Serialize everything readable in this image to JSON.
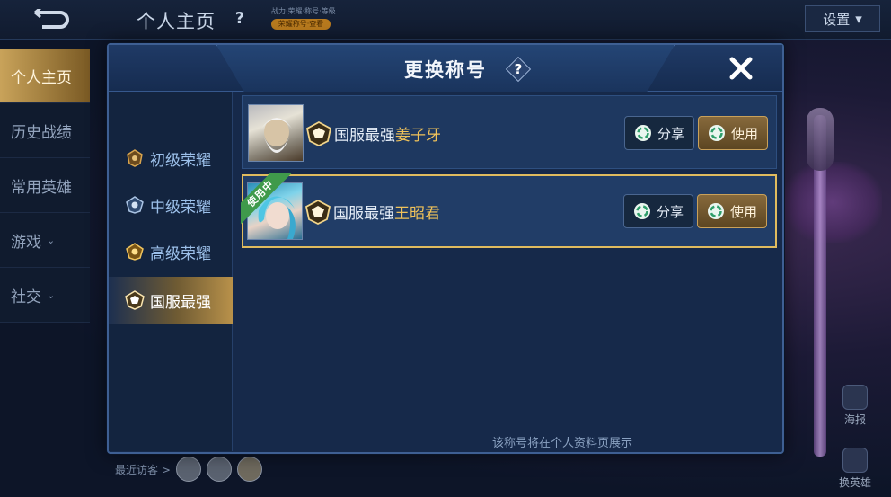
{
  "background": {
    "page_title": "个人主页",
    "help_label": "?",
    "badge_line1": "战力·荣耀·称号·等级",
    "badge_line2": "荣耀称号·查看",
    "settings_label": "设置",
    "settings_chevron": "▾",
    "side_nav": [
      {
        "label": "个人主页",
        "active": true,
        "chevron": ""
      },
      {
        "label": "历史战绩",
        "active": false,
        "chevron": ""
      },
      {
        "label": "常用英雄",
        "active": false,
        "chevron": ""
      },
      {
        "label": "游戏",
        "active": false,
        "chevron": "⌄"
      },
      {
        "label": "社交",
        "active": false,
        "chevron": "⌄"
      }
    ],
    "visitors_label": "最近访客 >",
    "right_tools": [
      {
        "label": "海报",
        "icon": "poster-icon"
      },
      {
        "label": "换英雄",
        "icon": "swap-hero-icon"
      }
    ]
  },
  "modal": {
    "title": "更换称号",
    "help_label": "?",
    "close_icon": "close-icon",
    "categories": [
      {
        "label": "初级荣耀",
        "active": false,
        "icon": "bronze-badge-icon",
        "color": "#c99a4a"
      },
      {
        "label": "中级荣耀",
        "active": false,
        "icon": "silver-badge-icon",
        "color": "#9fb8d8"
      },
      {
        "label": "高级荣耀",
        "active": false,
        "icon": "gold-badge-icon",
        "color": "#e2b54f"
      },
      {
        "label": "国服最强",
        "active": true,
        "icon": "supreme-badge-icon",
        "color": "#f3e2b0"
      }
    ],
    "titles": [
      {
        "prefix": "国服最强",
        "hero": "姜子牙",
        "avatar": "jiang-ziya-avatar",
        "in_use": false,
        "share_label": "分享",
        "use_label": "使用"
      },
      {
        "prefix": "国服最强",
        "hero": "王昭君",
        "avatar": "wang-zhaojun-avatar",
        "in_use": true,
        "in_use_label": "使用中",
        "share_label": "分享",
        "use_label": "使用"
      }
    ],
    "footer_note": "该称号将在个人资料页展示"
  },
  "colors": {
    "accent_gold": "#e0bb5e",
    "hero_name": "#f0c25a",
    "in_use_green": "#3f9a4b",
    "panel_blue": "#16294a"
  }
}
